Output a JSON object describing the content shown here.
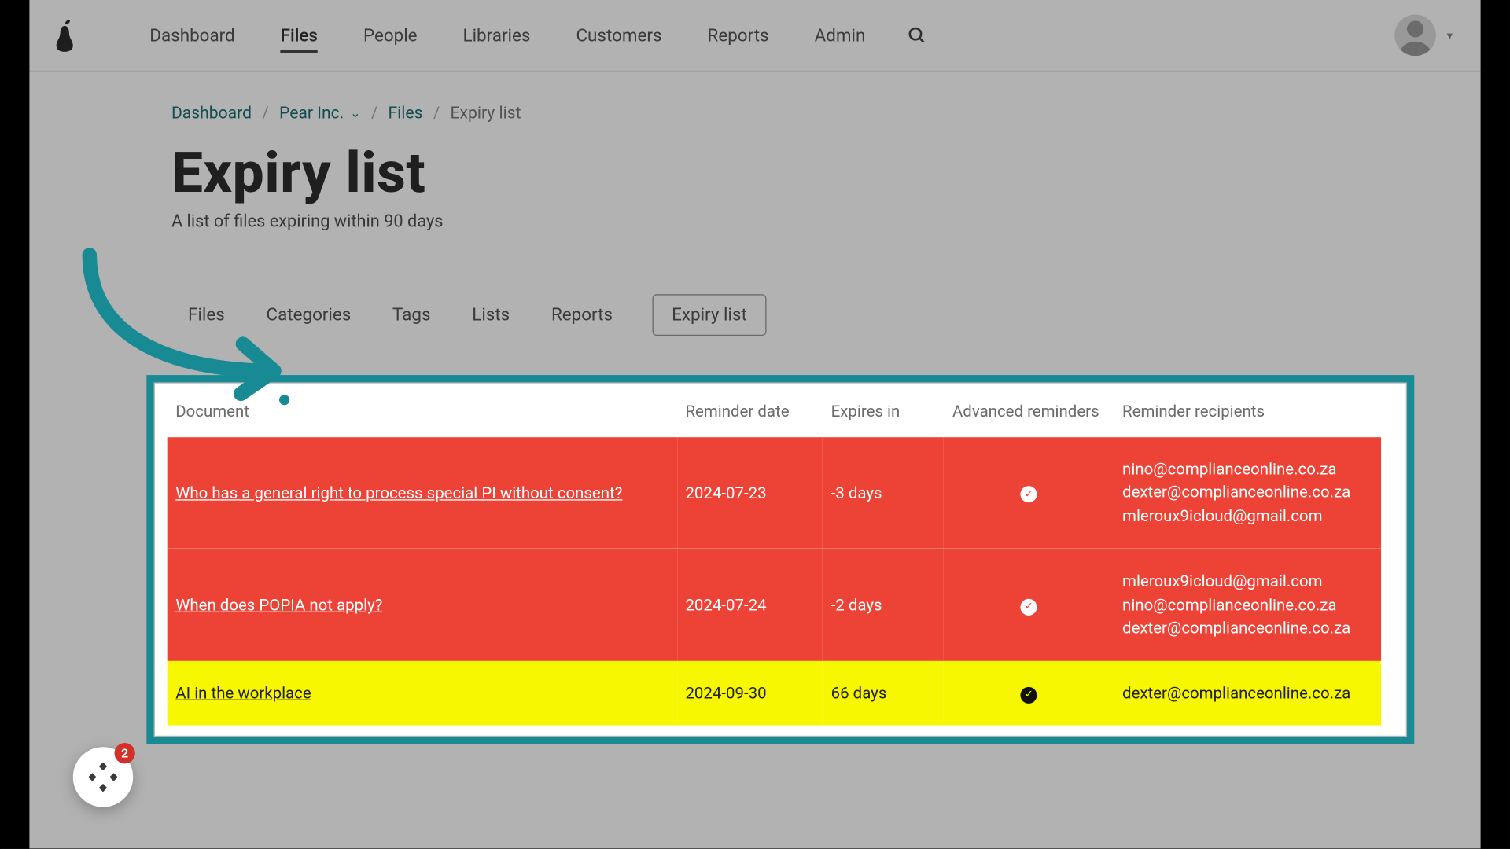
{
  "nav": {
    "items": [
      "Dashboard",
      "Files",
      "People",
      "Libraries",
      "Customers",
      "Reports",
      "Admin"
    ],
    "active": "Files"
  },
  "breadcrumb": {
    "dashboard": "Dashboard",
    "org": "Pear Inc.",
    "files": "Files",
    "current": "Expiry list"
  },
  "page": {
    "title": "Expiry list",
    "subtitle": "A list of files expiring within 90 days"
  },
  "subtabs": {
    "items": [
      "Files",
      "Categories",
      "Tags",
      "Lists",
      "Reports",
      "Expiry list"
    ],
    "active": "Expiry list"
  },
  "table": {
    "headers": [
      "Document",
      "Reminder date",
      "Expires in",
      "Advanced reminders",
      "Reminder recipients"
    ],
    "rows": [
      {
        "status": "red",
        "document": "Who has a general right to process special PI without consent?",
        "reminder_date": "2024-07-23",
        "expires_in": "-3 days",
        "advanced": true,
        "recipients": [
          "nino@complianceonline.co.za",
          "dexter@complianceonline.co.za",
          "mleroux9icloud@gmail.com"
        ]
      },
      {
        "status": "red",
        "document": "When does POPIA not apply?",
        "reminder_date": "2024-07-24",
        "expires_in": "-2 days",
        "advanced": true,
        "recipients": [
          "mleroux9icloud@gmail.com",
          "nino@complianceonline.co.za",
          "dexter@complianceonline.co.za"
        ]
      },
      {
        "status": "yellow",
        "document": "AI in the workplace",
        "reminder_date": "2024-09-30",
        "expires_in": "66 days",
        "advanced": true,
        "recipients": [
          "dexter@complianceonline.co.za"
        ]
      }
    ]
  },
  "widget": {
    "badge": "2"
  },
  "colors": {
    "teal": "#178a94",
    "red": "#ed4337",
    "yellow": "#f6f700"
  }
}
